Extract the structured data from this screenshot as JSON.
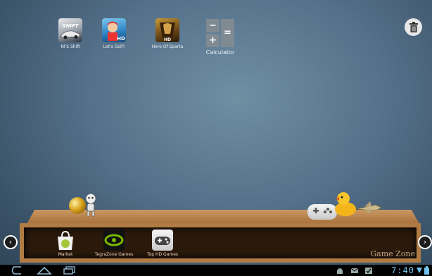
{
  "home": {
    "apps": [
      {
        "label": "NFS Shift",
        "icon": "nfs-shift-icon"
      },
      {
        "label": "Let's Golf!",
        "icon": "lets-golf-icon"
      },
      {
        "label": "Hero Of Sparta",
        "icon": "hero-of-sparta-icon"
      }
    ],
    "calculator": {
      "label": "Calculator",
      "keys": [
        "−",
        "+",
        "="
      ]
    },
    "trash_icon": "trash-icon"
  },
  "shelf": {
    "apps": [
      {
        "label": "Market",
        "icon": "market-icon"
      },
      {
        "label": "TegraZone Games",
        "icon": "tegrazone-icon"
      },
      {
        "label": "Top HD Games",
        "icon": "top-hd-games-icon"
      }
    ],
    "title": "Game Zone",
    "left_arrow": "‹",
    "right_arrow": "›"
  },
  "status": {
    "time": "7:40"
  },
  "colors": {
    "clock": "#6fc3ea",
    "nvidia_green": "#76b900",
    "market_green": "#a4c639"
  }
}
